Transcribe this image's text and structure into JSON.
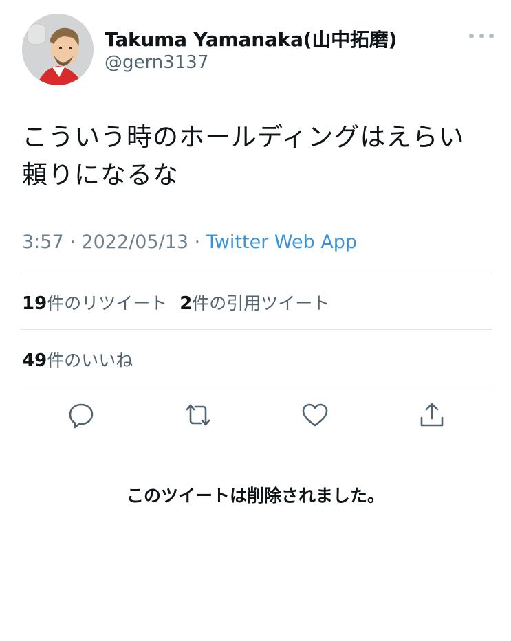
{
  "user": {
    "name": "Takuma Yamanaka(山中拓磨)",
    "handle": "@gern3137"
  },
  "tweet": {
    "text": "こういう時のホールディングはえらい頼りになるな",
    "time": "3:57",
    "date": "2022/05/13",
    "source": "Twitter Web App"
  },
  "stats": {
    "retweets_count": "19",
    "retweets_label": "件のリツイート",
    "quotes_count": "2",
    "quotes_label": "件の引用ツイート",
    "likes_count": "49",
    "likes_label": "件のいいね"
  },
  "deleted_notice": "このツイートは削除されました。",
  "icons": [
    "more-icon",
    "reply-icon",
    "retweet-icon",
    "like-icon",
    "share-icon"
  ],
  "colors": {
    "link": "#3b94d9",
    "icon": "#536471"
  }
}
